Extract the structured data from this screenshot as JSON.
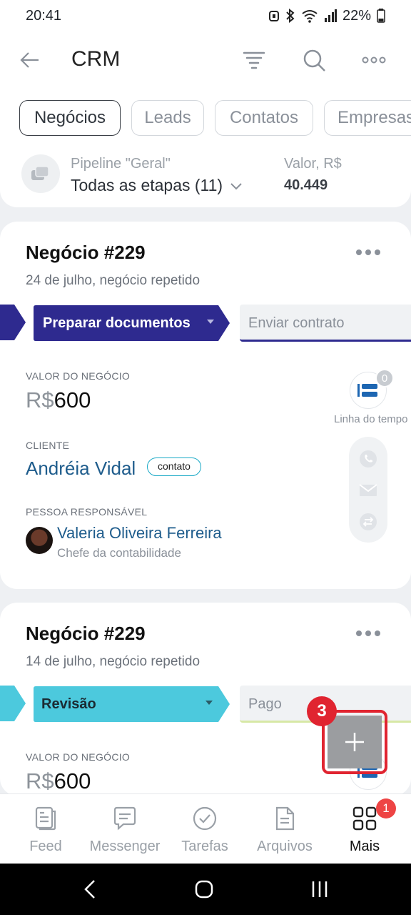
{
  "status": {
    "time": "20:41",
    "battery": "22%"
  },
  "header": {
    "title": "CRM"
  },
  "tabs": [
    {
      "label": "Negócios",
      "active": true
    },
    {
      "label": "Leads"
    },
    {
      "label": "Contatos"
    },
    {
      "label": "Empresas"
    }
  ],
  "pipeline": {
    "name": "Pipeline \"Geral\"",
    "stages": "Todas as etapas (11)",
    "value_label": "Valor, R$",
    "value": "40.449"
  },
  "deals": [
    {
      "title": "Negócio #229",
      "subtitle": "24 de julho, negócio repetido",
      "stage": "Preparar documentos",
      "next_stage": "Enviar contrato",
      "stage_color": "#2e2a8f",
      "amount_label": "VALOR DO NEGÓCIO",
      "currency": "R$",
      "amount": "600",
      "client_label": "CLIENTE",
      "client": "Andréia Vidal",
      "client_badge": "contato",
      "responsible_label": "PESSOA RESPONSÁVEL",
      "responsible": "Valeria Oliveira Ferreira",
      "responsible_role": "Chefe da contabilidade",
      "timeline_count": "0",
      "timeline_label": "Linha do tempo"
    },
    {
      "title": "Negócio #229",
      "subtitle": "14 de julho, negócio repetido",
      "stage": "Revisão",
      "next_stage": "Pago",
      "stage_color": "#4cc9dd",
      "amount_label": "VALOR DO NEGÓCIO",
      "currency": "R$",
      "amount": "600"
    }
  ],
  "annotation": {
    "step": "3"
  },
  "bottom_nav": [
    {
      "label": "Feed",
      "icon": "feed-icon"
    },
    {
      "label": "Messenger",
      "icon": "messenger-icon"
    },
    {
      "label": "Tarefas",
      "icon": "tasks-icon"
    },
    {
      "label": "Arquivos",
      "icon": "files-icon"
    },
    {
      "label": "Mais",
      "icon": "grid-icon",
      "active": true,
      "badge": "1"
    }
  ]
}
